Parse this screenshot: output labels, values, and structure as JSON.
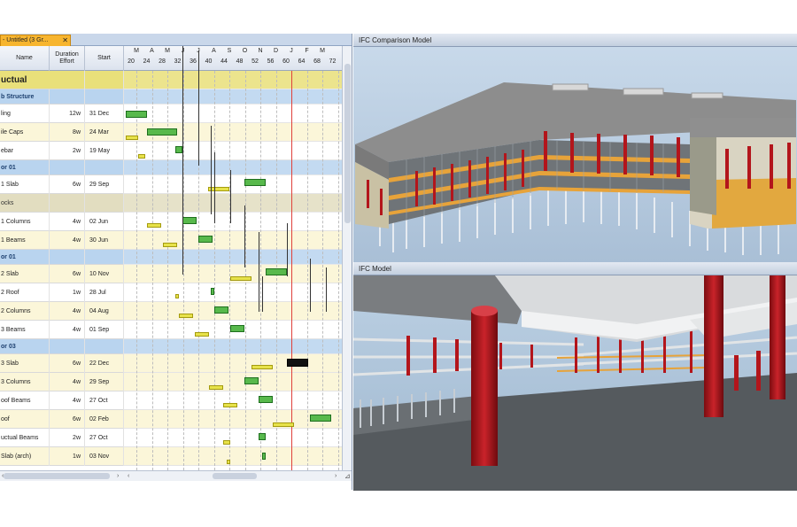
{
  "gantt": {
    "tab_label": "- Untitled (3 Gr...",
    "columns": {
      "name": "Name",
      "duration": "Duration Effort",
      "start": "Start"
    },
    "months": [
      "M",
      "A",
      "M",
      "J",
      "J",
      "A",
      "S",
      "O",
      "N",
      "D",
      "J",
      "F",
      "M"
    ],
    "weeks": [
      "20",
      "24",
      "28",
      "32",
      "36",
      "40",
      "44",
      "48",
      "52",
      "56",
      "60",
      "64",
      "68",
      "72"
    ],
    "rows": [
      {
        "type": "title",
        "name": "uctual",
        "duration": "",
        "start": ""
      },
      {
        "type": "section",
        "name": "b Structure",
        "duration": "",
        "start": ""
      },
      {
        "type": "task",
        "name": "ling",
        "duration": "12w",
        "start": "31 Dec"
      },
      {
        "type": "task",
        "alt": true,
        "name": "ile Caps",
        "duration": "8w",
        "start": "24 Mar"
      },
      {
        "type": "task",
        "name": "ebar",
        "duration": "2w",
        "start": "19 May"
      },
      {
        "type": "section",
        "name": "or 01",
        "duration": "",
        "start": ""
      },
      {
        "type": "task",
        "name": "1 Slab",
        "duration": "6w",
        "start": "29 Sep"
      },
      {
        "type": "sub",
        "name": "ocks",
        "duration": "",
        "start": ""
      },
      {
        "type": "task",
        "name": "1 Columns",
        "duration": "4w",
        "start": "02 Jun"
      },
      {
        "type": "task",
        "alt": true,
        "name": "1 Beams",
        "duration": "4w",
        "start": "30 Jun"
      },
      {
        "type": "section",
        "name": "or 01",
        "duration": "",
        "start": ""
      },
      {
        "type": "task",
        "alt": true,
        "name": "2 Slab",
        "duration": "6w",
        "start": "10 Nov"
      },
      {
        "type": "task",
        "name": "2 Roof",
        "duration": "1w",
        "start": "28 Jul"
      },
      {
        "type": "task",
        "alt": true,
        "name": "2 Columns",
        "duration": "4w",
        "start": "04 Aug"
      },
      {
        "type": "task",
        "name": "3 Beams",
        "duration": "4w",
        "start": "01 Sep"
      },
      {
        "type": "section",
        "name": "or 03",
        "duration": "",
        "start": ""
      },
      {
        "type": "task",
        "alt": true,
        "name": "3 Slab",
        "duration": "6w",
        "start": "22 Dec"
      },
      {
        "type": "task",
        "alt": true,
        "name": "3 Columns",
        "duration": "4w",
        "start": "29 Sep"
      },
      {
        "type": "task",
        "name": "oof Beams",
        "duration": "4w",
        "start": "27 Oct"
      },
      {
        "type": "task",
        "alt": true,
        "name": "oof",
        "duration": "6w",
        "start": "02 Feb"
      },
      {
        "type": "task",
        "name": "uctual Beams",
        "duration": "2w",
        "start": "27 Oct"
      },
      {
        "type": "task",
        "alt": true,
        "name": "Slab (arch)",
        "duration": "1w",
        "start": "03 Nov"
      }
    ]
  },
  "panels": {
    "comparison_title": "IFC Comparison Model",
    "model_title": "IFC Model"
  },
  "colors": {
    "accent_tab": "#f7b52f",
    "bar_actual": "#58b94c",
    "bar_baseline": "#e7e24a",
    "section_bg": "#b9d4ef",
    "today_line": "#e0413b",
    "column_red": "#b3151b"
  },
  "icons": [
    "close-icon",
    "scroll-left-arrow-icon",
    "scroll-right-arrow-icon",
    "resize-grip-icon"
  ]
}
